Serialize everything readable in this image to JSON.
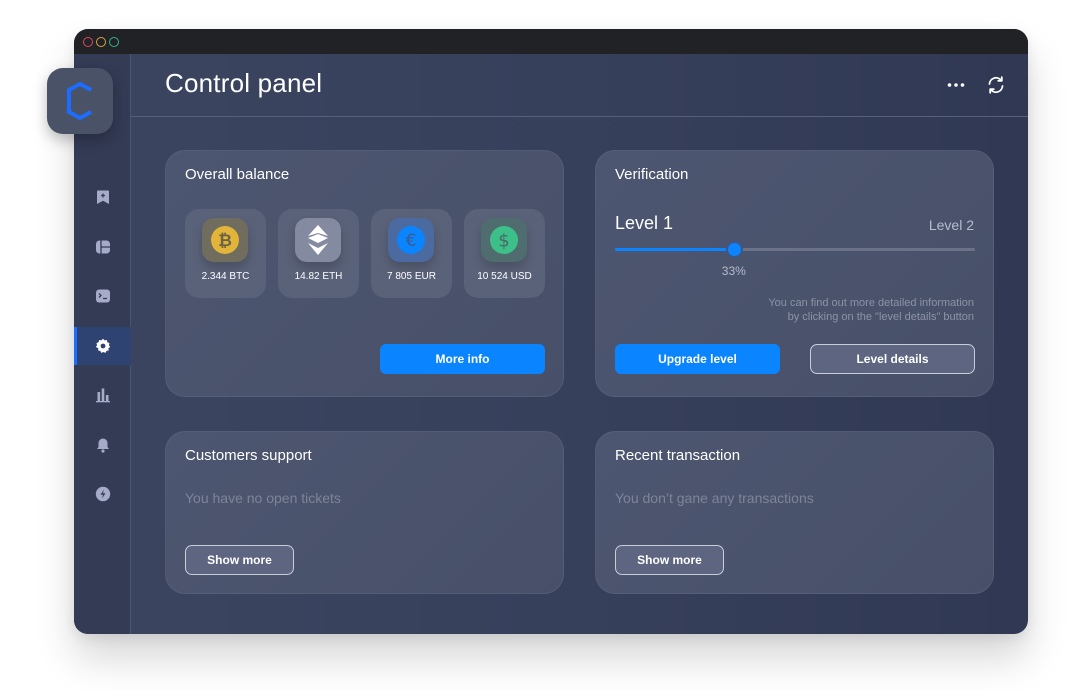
{
  "window": {
    "traffic_lights": [
      "close",
      "minimize",
      "maximize"
    ]
  },
  "app": {
    "logo_icon": "hexagon-c-logo",
    "brand_color": "#1c6dff"
  },
  "sidebar": {
    "items": [
      {
        "icon": "bookmark-add-icon",
        "active": false
      },
      {
        "icon": "layout-icon",
        "active": false
      },
      {
        "icon": "terminal-icon",
        "active": false
      },
      {
        "icon": "gear-icon",
        "active": true
      },
      {
        "icon": "bar-chart-icon",
        "active": false
      },
      {
        "icon": "bell-icon",
        "active": false
      },
      {
        "icon": "lightning-icon",
        "active": false
      }
    ]
  },
  "header": {
    "title": "Control panel",
    "more_icon": "more-horizontal-icon",
    "refresh_icon": "refresh-icon"
  },
  "balance": {
    "title": "Overall balance",
    "coins": [
      {
        "symbol": "BTC",
        "label": "2.344 BTC",
        "icon": "bitcoin-icon",
        "color": "#e2b43a"
      },
      {
        "symbol": "ETH",
        "label": "14.82 ETH",
        "icon": "ethereum-icon",
        "color": "#ffffff"
      },
      {
        "symbol": "EUR",
        "label": "7 805 EUR",
        "icon": "euro-icon",
        "color": "#0a84ff"
      },
      {
        "symbol": "USD",
        "label": "10 524 USD",
        "icon": "dollar-icon",
        "color": "#3dbf8a"
      }
    ],
    "more_info_label": "More info"
  },
  "verification": {
    "title": "Verification",
    "current_level": "Level 1",
    "next_level": "Level 2",
    "progress_percent": 33,
    "progress_label": "33%",
    "info_line1": "You can find out more detailed information",
    "info_line2": "by clicking on the \"level details\" button",
    "upgrade_label": "Upgrade level",
    "details_label": "Level details"
  },
  "support": {
    "title": "Customers support",
    "empty_text": "You have no open tickets",
    "show_more_label": "Show more"
  },
  "transactions": {
    "title": "Recent transaction",
    "empty_text": "You don’t gane any transactions",
    "show_more_label": "Show more"
  },
  "colors": {
    "accent": "#0a84ff",
    "panel_bg": "#363f5a",
    "card_bg": "#4d5670"
  }
}
